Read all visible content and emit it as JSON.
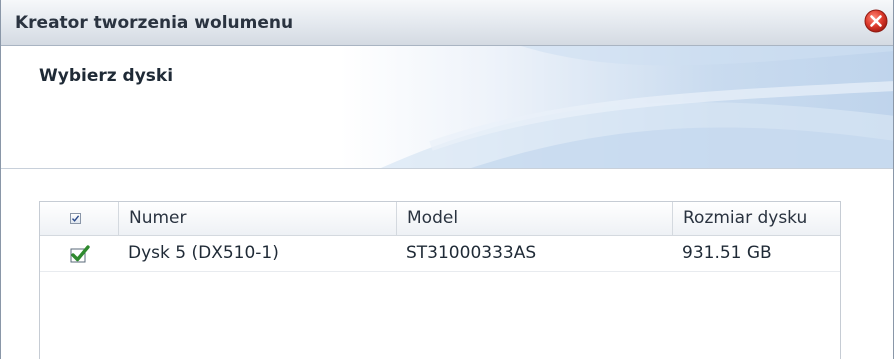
{
  "window": {
    "title": "Kreator tworzenia wolumenu"
  },
  "header": {
    "title": "Wybierz dyski"
  },
  "table": {
    "columns": [
      "Numer",
      "Model",
      "Rozmiar dysku"
    ],
    "header_checkbox_checked": true,
    "rows": [
      {
        "checked": true,
        "number": "Dysk 5 (DX510-1)",
        "model": "ST31000333AS",
        "size": "931.51 GB"
      }
    ]
  },
  "icons": {
    "close": "close-icon",
    "checkbox": "checkbox-checked-icon"
  },
  "colors": {
    "accent": "#2f8a2f",
    "close": "#d7382b",
    "header_blue": "#bfd4ec"
  }
}
